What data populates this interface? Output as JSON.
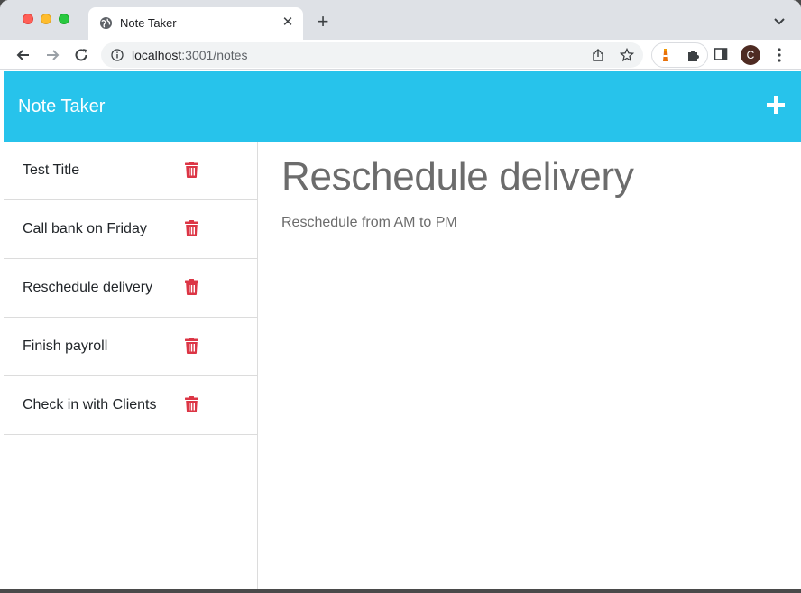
{
  "browser": {
    "tab_title": "Note Taker",
    "url_host": "localhost",
    "url_path": ":3001/notes",
    "avatar_letter": "C"
  },
  "app": {
    "brand": "Note Taker",
    "colors": {
      "navbar": "#27c3eb",
      "trash": "#dc3545"
    },
    "notes": [
      {
        "title": "Test Title"
      },
      {
        "title": "Call bank on Friday"
      },
      {
        "title": "Reschedule delivery"
      },
      {
        "title": "Finish payroll"
      },
      {
        "title": "Check in with Clients"
      }
    ],
    "active_note": {
      "title": "Reschedule delivery",
      "text": "Reschedule from AM to PM"
    }
  }
}
